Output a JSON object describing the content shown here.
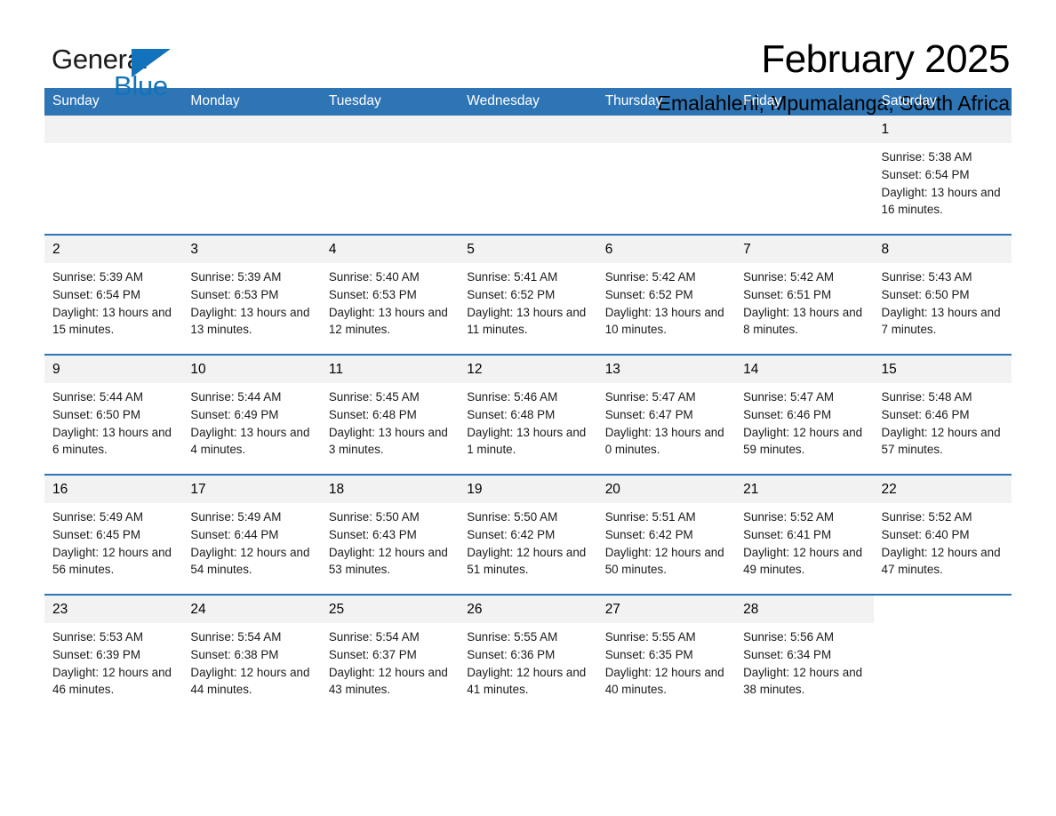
{
  "logo": {
    "word_one": "General",
    "word_two": "Blue",
    "triangle": "triangle-logo-mark",
    "brand_color": "#1272bb"
  },
  "header": {
    "month_title": "February 2025",
    "location": "Emalahleni, Mpumalanga, South Africa"
  },
  "calendar": {
    "header_bg": "#2e75b6",
    "daynum_bg": "#f2f2f2",
    "weekdays": [
      "Sunday",
      "Monday",
      "Tuesday",
      "Wednesday",
      "Thursday",
      "Friday",
      "Saturday"
    ],
    "weeks": [
      [
        {
          "day": "",
          "blank": true
        },
        {
          "day": "",
          "blank": true
        },
        {
          "day": "",
          "blank": true
        },
        {
          "day": "",
          "blank": true
        },
        {
          "day": "",
          "blank": true
        },
        {
          "day": "",
          "blank": true
        },
        {
          "day": "1",
          "sunrise": "Sunrise: 5:38 AM",
          "sunset": "Sunset: 6:54 PM",
          "daylight": "Daylight: 13 hours and 16 minutes."
        }
      ],
      [
        {
          "day": "2",
          "sunrise": "Sunrise: 5:39 AM",
          "sunset": "Sunset: 6:54 PM",
          "daylight": "Daylight: 13 hours and 15 minutes."
        },
        {
          "day": "3",
          "sunrise": "Sunrise: 5:39 AM",
          "sunset": "Sunset: 6:53 PM",
          "daylight": "Daylight: 13 hours and 13 minutes."
        },
        {
          "day": "4",
          "sunrise": "Sunrise: 5:40 AM",
          "sunset": "Sunset: 6:53 PM",
          "daylight": "Daylight: 13 hours and 12 minutes."
        },
        {
          "day": "5",
          "sunrise": "Sunrise: 5:41 AM",
          "sunset": "Sunset: 6:52 PM",
          "daylight": "Daylight: 13 hours and 11 minutes."
        },
        {
          "day": "6",
          "sunrise": "Sunrise: 5:42 AM",
          "sunset": "Sunset: 6:52 PM",
          "daylight": "Daylight: 13 hours and 10 minutes."
        },
        {
          "day": "7",
          "sunrise": "Sunrise: 5:42 AM",
          "sunset": "Sunset: 6:51 PM",
          "daylight": "Daylight: 13 hours and 8 minutes."
        },
        {
          "day": "8",
          "sunrise": "Sunrise: 5:43 AM",
          "sunset": "Sunset: 6:50 PM",
          "daylight": "Daylight: 13 hours and 7 minutes."
        }
      ],
      [
        {
          "day": "9",
          "sunrise": "Sunrise: 5:44 AM",
          "sunset": "Sunset: 6:50 PM",
          "daylight": "Daylight: 13 hours and 6 minutes."
        },
        {
          "day": "10",
          "sunrise": "Sunrise: 5:44 AM",
          "sunset": "Sunset: 6:49 PM",
          "daylight": "Daylight: 13 hours and 4 minutes."
        },
        {
          "day": "11",
          "sunrise": "Sunrise: 5:45 AM",
          "sunset": "Sunset: 6:48 PM",
          "daylight": "Daylight: 13 hours and 3 minutes."
        },
        {
          "day": "12",
          "sunrise": "Sunrise: 5:46 AM",
          "sunset": "Sunset: 6:48 PM",
          "daylight": "Daylight: 13 hours and 1 minute."
        },
        {
          "day": "13",
          "sunrise": "Sunrise: 5:47 AM",
          "sunset": "Sunset: 6:47 PM",
          "daylight": "Daylight: 13 hours and 0 minutes."
        },
        {
          "day": "14",
          "sunrise": "Sunrise: 5:47 AM",
          "sunset": "Sunset: 6:46 PM",
          "daylight": "Daylight: 12 hours and 59 minutes."
        },
        {
          "day": "15",
          "sunrise": "Sunrise: 5:48 AM",
          "sunset": "Sunset: 6:46 PM",
          "daylight": "Daylight: 12 hours and 57 minutes."
        }
      ],
      [
        {
          "day": "16",
          "sunrise": "Sunrise: 5:49 AM",
          "sunset": "Sunset: 6:45 PM",
          "daylight": "Daylight: 12 hours and 56 minutes."
        },
        {
          "day": "17",
          "sunrise": "Sunrise: 5:49 AM",
          "sunset": "Sunset: 6:44 PM",
          "daylight": "Daylight: 12 hours and 54 minutes."
        },
        {
          "day": "18",
          "sunrise": "Sunrise: 5:50 AM",
          "sunset": "Sunset: 6:43 PM",
          "daylight": "Daylight: 12 hours and 53 minutes."
        },
        {
          "day": "19",
          "sunrise": "Sunrise: 5:50 AM",
          "sunset": "Sunset: 6:42 PM",
          "daylight": "Daylight: 12 hours and 51 minutes."
        },
        {
          "day": "20",
          "sunrise": "Sunrise: 5:51 AM",
          "sunset": "Sunset: 6:42 PM",
          "daylight": "Daylight: 12 hours and 50 minutes."
        },
        {
          "day": "21",
          "sunrise": "Sunrise: 5:52 AM",
          "sunset": "Sunset: 6:41 PM",
          "daylight": "Daylight: 12 hours and 49 minutes."
        },
        {
          "day": "22",
          "sunrise": "Sunrise: 5:52 AM",
          "sunset": "Sunset: 6:40 PM",
          "daylight": "Daylight: 12 hours and 47 minutes."
        }
      ],
      [
        {
          "day": "23",
          "sunrise": "Sunrise: 5:53 AM",
          "sunset": "Sunset: 6:39 PM",
          "daylight": "Daylight: 12 hours and 46 minutes."
        },
        {
          "day": "24",
          "sunrise": "Sunrise: 5:54 AM",
          "sunset": "Sunset: 6:38 PM",
          "daylight": "Daylight: 12 hours and 44 minutes."
        },
        {
          "day": "25",
          "sunrise": "Sunrise: 5:54 AM",
          "sunset": "Sunset: 6:37 PM",
          "daylight": "Daylight: 12 hours and 43 minutes."
        },
        {
          "day": "26",
          "sunrise": "Sunrise: 5:55 AM",
          "sunset": "Sunset: 6:36 PM",
          "daylight": "Daylight: 12 hours and 41 minutes."
        },
        {
          "day": "27",
          "sunrise": "Sunrise: 5:55 AM",
          "sunset": "Sunset: 6:35 PM",
          "daylight": "Daylight: 12 hours and 40 minutes."
        },
        {
          "day": "28",
          "sunrise": "Sunrise: 5:56 AM",
          "sunset": "Sunset: 6:34 PM",
          "daylight": "Daylight: 12 hours and 38 minutes."
        },
        {
          "day": "",
          "blank": true
        }
      ]
    ]
  }
}
